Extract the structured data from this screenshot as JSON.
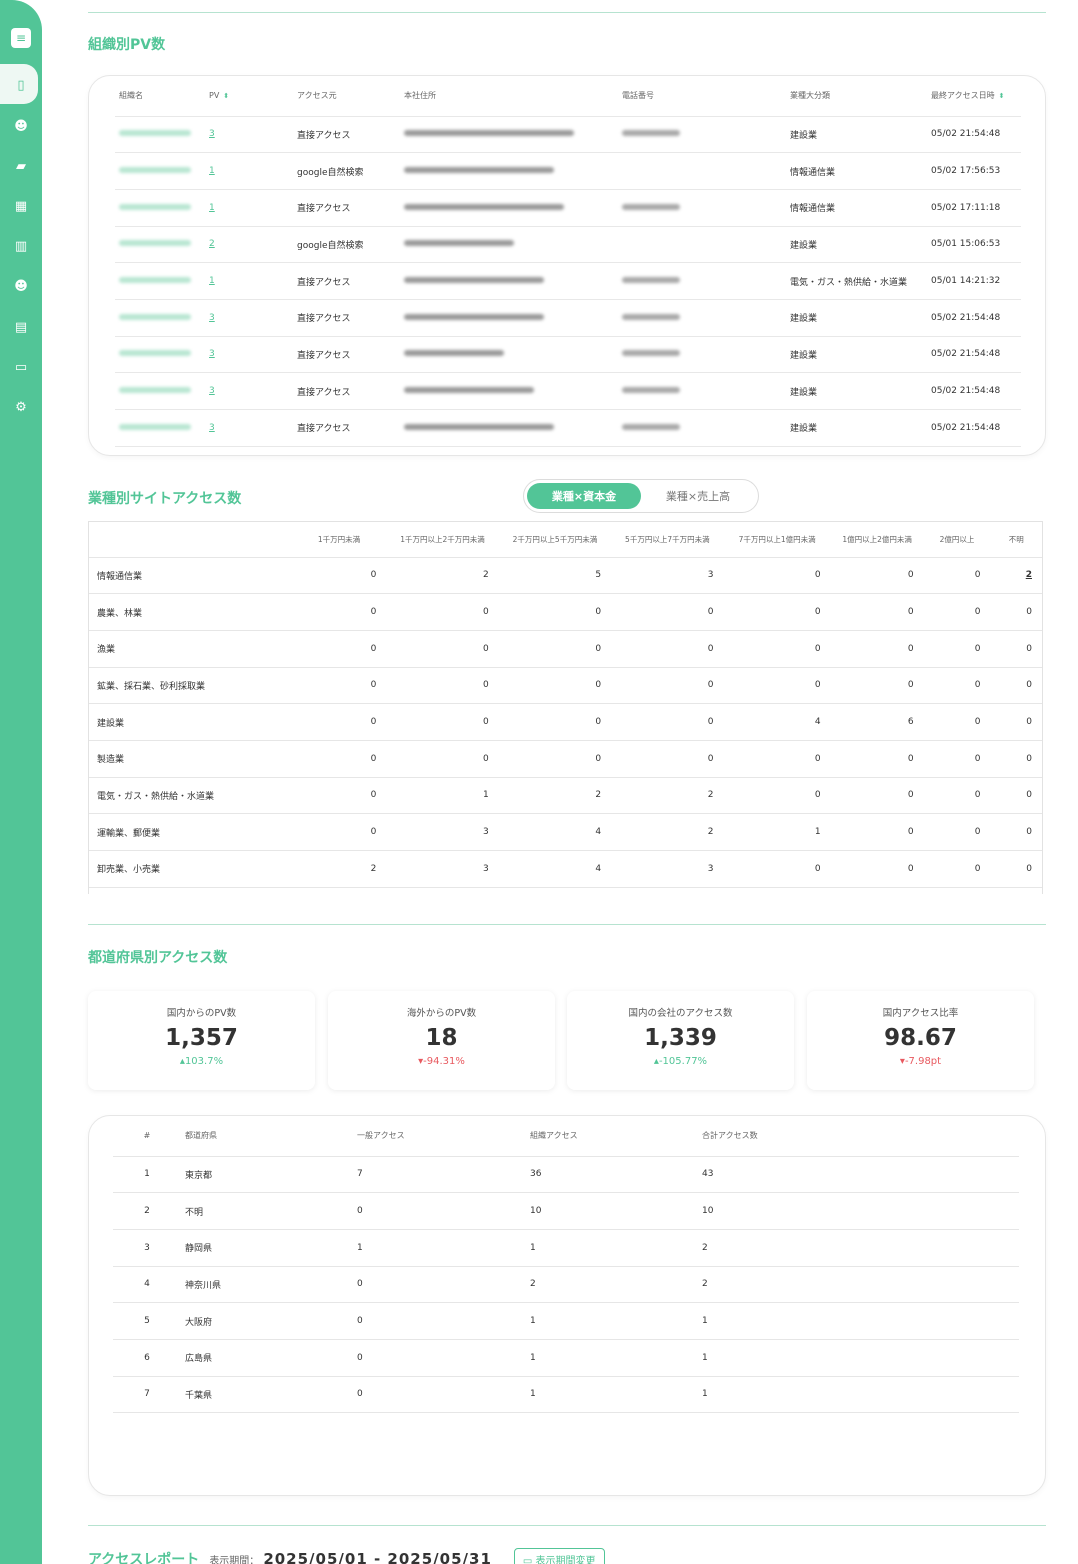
{
  "sidebar": {
    "icons": [
      "menu-icon",
      "clipboard-icon",
      "user-gear-icon",
      "folder-icon",
      "calculator-icon",
      "bar-chart-icon",
      "users-icon",
      "building-icon",
      "calendar-icon",
      "gear-icon"
    ]
  },
  "org_pv": {
    "title": "組織別PV数",
    "headers": [
      "組織名",
      "PV",
      "アクセス元",
      "本社住所",
      "電話番号",
      "業種大分類",
      "最終アクセス日時"
    ],
    "rows": [
      {
        "pv": "3",
        "source": "直接アクセス",
        "industry": "建設業",
        "last": "05/02 21:54:48",
        "has_phone": true
      },
      {
        "pv": "1",
        "source": "google自然検索",
        "industry": "情報通信業",
        "last": "05/02 17:56:53",
        "has_phone": false
      },
      {
        "pv": "1",
        "source": "直接アクセス",
        "industry": "情報通信業",
        "last": "05/02 17:11:18",
        "has_phone": true
      },
      {
        "pv": "2",
        "source": "google自然検索",
        "industry": "建設業",
        "last": "05/01 15:06:53",
        "has_phone": false
      },
      {
        "pv": "1",
        "source": "直接アクセス",
        "industry": "電気・ガス・熱供給・水道業",
        "last": "05/01 14:21:32",
        "has_phone": true
      },
      {
        "pv": "3",
        "source": "直接アクセス",
        "industry": "建設業",
        "last": "05/02 21:54:48",
        "has_phone": true
      },
      {
        "pv": "3",
        "source": "直接アクセス",
        "industry": "建設業",
        "last": "05/02 21:54:48",
        "has_phone": true
      },
      {
        "pv": "3",
        "source": "直接アクセス",
        "industry": "建設業",
        "last": "05/02 21:54:48",
        "has_phone": true
      },
      {
        "pv": "3",
        "source": "直接アクセス",
        "industry": "建設業",
        "last": "05/02 21:54:48",
        "has_phone": true
      }
    ]
  },
  "industry": {
    "title": "業種別サイトアクセス数",
    "toggle": [
      "業種×資本金",
      "業種×売上高"
    ],
    "headers": [
      "",
      "1千万円未満",
      "1千万円以上2千万円未満",
      "2千万円以上5千万円未満",
      "5千万円以上7千万円未満",
      "7千万円以上1億円未満",
      "1億円以上2億円未満",
      "2億円以上",
      "不明"
    ],
    "rows": [
      {
        "label": "情報通信業",
        "values": [
          "0",
          "2",
          "5",
          "3",
          "0",
          "0",
          "0",
          "2"
        ]
      },
      {
        "label": "農業、林業",
        "values": [
          "0",
          "0",
          "0",
          "0",
          "0",
          "0",
          "0",
          "0"
        ]
      },
      {
        "label": "漁業",
        "values": [
          "0",
          "0",
          "0",
          "0",
          "0",
          "0",
          "0",
          "0"
        ]
      },
      {
        "label": "鉱業、採石業、砂利採取業",
        "values": [
          "0",
          "0",
          "0",
          "0",
          "0",
          "0",
          "0",
          "0"
        ]
      },
      {
        "label": "建設業",
        "values": [
          "0",
          "0",
          "0",
          "0",
          "4",
          "6",
          "0",
          "0"
        ]
      },
      {
        "label": "製造業",
        "values": [
          "0",
          "0",
          "0",
          "0",
          "0",
          "0",
          "0",
          "0"
        ]
      },
      {
        "label": "電気・ガス・熱供給・水道業",
        "values": [
          "0",
          "1",
          "2",
          "2",
          "0",
          "0",
          "0",
          "0"
        ]
      },
      {
        "label": "運輸業、郵便業",
        "values": [
          "0",
          "3",
          "4",
          "2",
          "1",
          "0",
          "0",
          "0"
        ]
      },
      {
        "label": "卸売業、小売業",
        "values": [
          "2",
          "3",
          "4",
          "3",
          "0",
          "0",
          "0",
          "0"
        ]
      }
    ]
  },
  "pref": {
    "title": "都道府県別アクセス数",
    "stats": [
      {
        "label": "国内からのPV数",
        "value": "1,357",
        "change": "103.7%",
        "dir": "up"
      },
      {
        "label": "海外からのPV数",
        "value": "18",
        "change": "-94.31%",
        "dir": "dn"
      },
      {
        "label": "国内の会社のアクセス数",
        "value": "1,339",
        "change": "-105.77%",
        "dir": "up"
      },
      {
        "label": "国内アクセス比率",
        "value": "98.67",
        "change": "-7.98pt",
        "dir": "dn"
      }
    ],
    "headers": [
      "#",
      "都道府県",
      "一般アクセス",
      "組織アクセス",
      "合計アクセス数"
    ],
    "rows": [
      [
        "1",
        "東京都",
        "7",
        "36",
        "43"
      ],
      [
        "2",
        "不明",
        "0",
        "10",
        "10"
      ],
      [
        "3",
        "静岡県",
        "1",
        "1",
        "2"
      ],
      [
        "4",
        "神奈川県",
        "0",
        "2",
        "2"
      ],
      [
        "5",
        "大阪府",
        "0",
        "1",
        "1"
      ],
      [
        "6",
        "広島県",
        "0",
        "1",
        "1"
      ],
      [
        "7",
        "千葉県",
        "0",
        "1",
        "1"
      ]
    ]
  },
  "report": {
    "title": "アクセスレポート",
    "period_label": "表示期間：",
    "period": "2025/05/01 - 2025/05/31",
    "button": "表示期間変更"
  },
  "colors": {
    "accent": "#52c597",
    "negative": "#e8595f"
  }
}
